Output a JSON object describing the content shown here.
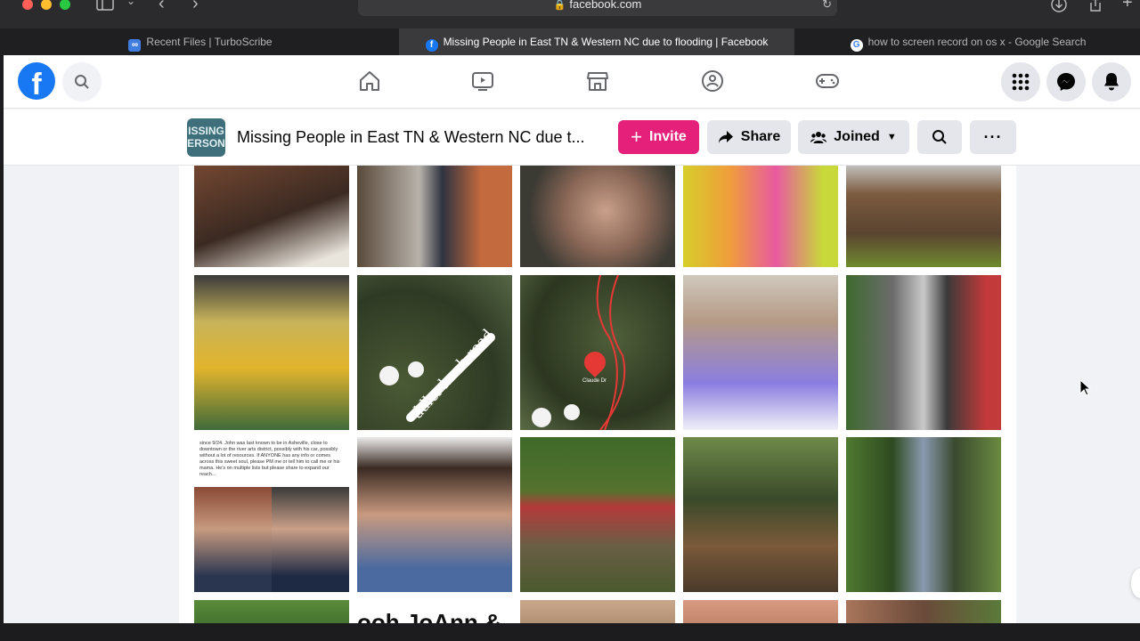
{
  "browser": {
    "url": "facebook.com",
    "tabs": [
      {
        "label": "Recent Files | TurboScribe",
        "active": false
      },
      {
        "label": "Missing People in East TN & Western NC due to flooding | Facebook",
        "active": true
      },
      {
        "label": "how to screen record on os x - Google Search",
        "active": false
      }
    ]
  },
  "header": {
    "logo_letter": "f",
    "group_thumb": "ISSING\nERSON",
    "group_title": "Missing People in East TN & Western NC due t...",
    "invite_label": "Invite",
    "share_label": "Share",
    "joined_label": "Joined"
  },
  "photos": {
    "caption_post": "since 9/24. John was last known to be in Asheville, close to downtown or the river arts district, possibly with his car, possibly without a lot of resources. If ANYONE has any info or comes across this sweet soul, please PM me or tell him to call me or his mama. He's on multiple lists but please share to expand our reach...",
    "map_road_label": "ddler knob road",
    "map_pin_label": "Claude Dr",
    "partial_text": "ooh JoAnn &"
  },
  "colors": {
    "brand": "#1877f2",
    "invite": "#e4207b"
  }
}
